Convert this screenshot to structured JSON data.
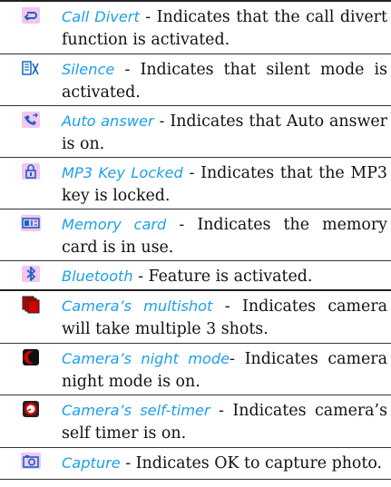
{
  "colors": {
    "term": "#1ea0e6",
    "icon_pink": "#f5c6ee",
    "icon_blue": "#1565c8",
    "dark": "#222222",
    "red": "#d40000"
  },
  "rows": [
    {
      "icon": "call-divert-icon",
      "term": "Call Divert",
      "text": " - Indicates that the call divert function is activated."
    },
    {
      "icon": "silence-icon",
      "term": "Silence",
      "text": " - Indicates that silent mode is activated."
    },
    {
      "icon": "auto-answer-icon",
      "term": "Auto answer",
      "text": " - Indicates that Auto answer is on."
    },
    {
      "icon": "mp3-key-locked-icon",
      "term": "MP3 Key Locked",
      "text": " - Indicates that the MP3 key is locked."
    },
    {
      "icon": "memory-card-icon",
      "term": "Memory card",
      "text": " - Indicates the memory card is in use."
    },
    {
      "icon": "bluetooth-icon",
      "term": "Bluetooth",
      "text": " - Feature is activated."
    },
    {
      "icon": "multishot-icon",
      "term": "Camera’s multishot",
      "text": " - Indicates camera will take multiple 3 shots."
    },
    {
      "icon": "night-mode-icon",
      "term": "Camera’s night mode",
      "text": "- Indicates camera night mode is on."
    },
    {
      "icon": "self-timer-icon",
      "term": "Camera’s self-timer",
      "text": " - Indicates camera’s self timer is on."
    },
    {
      "icon": "capture-icon",
      "term": "Capture",
      "text": " - Indicates OK to capture photo."
    }
  ]
}
